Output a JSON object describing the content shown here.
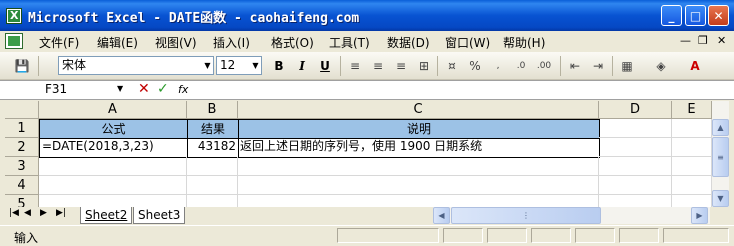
{
  "window": {
    "title": "Microsoft Excel - DATE函数 - caohaifeng.com"
  },
  "menu": [
    "文件(F)",
    "编辑(E)",
    "视图(V)",
    "插入(I)",
    "格式(O)",
    "工具(T)",
    "数据(D)",
    "窗口(W)",
    "帮助(H)"
  ],
  "toolbar": {
    "font_name": "宋体",
    "font_size": "12"
  },
  "formula_bar": {
    "cell_ref": "F31",
    "fx_label": "fx",
    "formula": ""
  },
  "columns": [
    "A",
    "B",
    "C",
    "D",
    "E"
  ],
  "rows": [
    "1",
    "2",
    "3",
    "4",
    "5"
  ],
  "table": {
    "headers": [
      "公式",
      "结果",
      "说明"
    ],
    "row": [
      "=DATE(2018,3,23)",
      "43182",
      "返回上述日期的序列号，使用 1900 日期系统"
    ]
  },
  "sheets": [
    "Sheet2",
    "Sheet3"
  ],
  "status": {
    "text": "输入"
  },
  "colors": {
    "header_fill": "#9cc2e6",
    "title_bar": "#0853d2"
  }
}
